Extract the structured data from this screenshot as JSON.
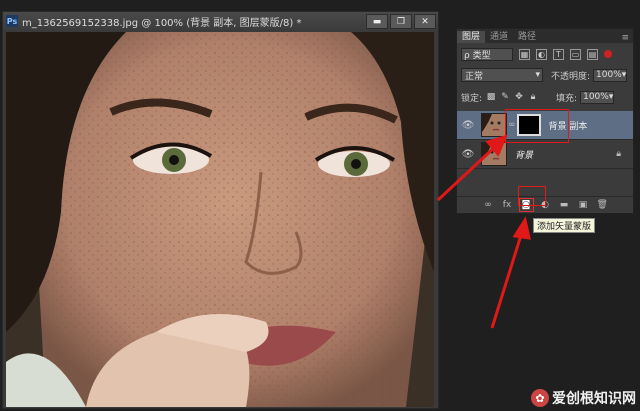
{
  "document": {
    "ps_badge": "Ps",
    "title": "m_1362569152338.jpg @ 100% (背景 副本, 图层蒙版/8) *",
    "buttons": [
      "▬",
      "❐",
      "✕"
    ]
  },
  "layers_panel": {
    "tabs": [
      "图层",
      "通道",
      "路径"
    ],
    "menu_glyph": "≡",
    "filter_kind": "ρ 类型",
    "blend_mode": "正常",
    "opacity_label": "不透明度:",
    "opacity_value": "100%",
    "lock_label": "锁定:",
    "fill_label": "填充:",
    "fill_value": "100%",
    "layers": [
      {
        "name": "背景 副本",
        "selected": true,
        "has_mask": true
      },
      {
        "name": "背景",
        "selected": false,
        "has_mask": false
      }
    ],
    "bottom_icons": [
      "link-icon",
      "fx-icon",
      "add-mask-icon",
      "adjustment-icon",
      "folder-icon",
      "new-layer-icon",
      "trash-icon"
    ]
  },
  "tooltip": "添加矢量蒙版",
  "watermark": "爱创根知识网",
  "colors": {
    "highlight": "#e01818",
    "selected_layer": "#5e6f85"
  }
}
